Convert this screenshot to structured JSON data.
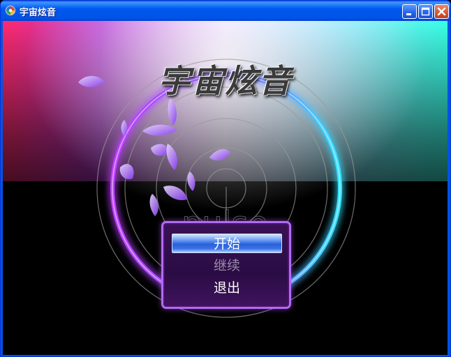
{
  "window": {
    "title": "宇宙炫音",
    "app_icon": "swirl-app-icon",
    "controls": [
      "minimize-icon",
      "maximize-icon",
      "close-icon"
    ]
  },
  "game": {
    "title_logo": "宇宙炫音",
    "watermark": "pulse",
    "menu": {
      "items": [
        {
          "label": "开始",
          "state": "selected"
        },
        {
          "label": "继续",
          "state": "disabled"
        },
        {
          "label": "退出",
          "state": "normal"
        }
      ]
    }
  },
  "colors": {
    "ring_glow_left": "#b040ff",
    "ring_glow_right": "#30e0ff",
    "menu_border": "#b06bf2",
    "menu_selected": "#3a74e8",
    "titlebar": "#0058ee"
  }
}
